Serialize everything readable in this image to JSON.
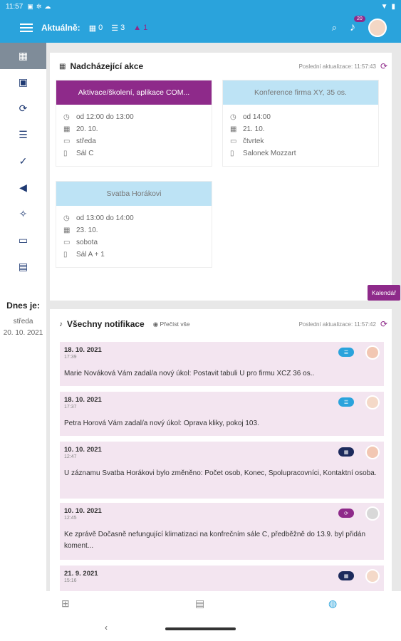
{
  "status": {
    "time": "11:57"
  },
  "appbar": {
    "aktualne_label": "Aktuálně:",
    "counters": [
      {
        "icon": "calendar-icon",
        "value": "0"
      },
      {
        "icon": "tasks-icon",
        "value": "3"
      },
      {
        "icon": "warning-icon",
        "value": "1"
      }
    ],
    "notifications_badge": "20"
  },
  "sidebar": {
    "items": [
      {
        "icon": "dashboard-grid-icon"
      },
      {
        "icon": "calendar-check-icon"
      },
      {
        "icon": "refresh-icon"
      },
      {
        "icon": "task-list-icon"
      },
      {
        "icon": "check-circle-icon"
      },
      {
        "icon": "megaphone-icon"
      },
      {
        "icon": "lightbulb-icon"
      },
      {
        "icon": "folder-icon"
      },
      {
        "icon": "calendar-grid-icon"
      }
    ],
    "today_label": "Dnes je:",
    "today_day": "středa",
    "today_date": "20. 10. 2021"
  },
  "upcoming": {
    "title": "Nadcházející akce",
    "updated": "Poslední aktualizace: 11:57:43",
    "calendar_button": "Kalendář",
    "events": [
      {
        "title": "Aktivace/školení, aplikace COM...",
        "time": "od 12:00 do 13:00",
        "date": "20. 10.",
        "day": "středa",
        "room": "Sál C"
      },
      {
        "title": "Konference firma XY, 35 os.",
        "time": "od 14:00",
        "date": "21. 10.",
        "day": "čtvrtek",
        "room": "Salonek Mozzart"
      },
      {
        "title": "Svatba Horákovi",
        "time": "od 13:00 do 14:00",
        "date": "23. 10.",
        "day": "sobota",
        "room": "Sál A + 1"
      }
    ]
  },
  "notifications": {
    "title": "Všechny notifikace",
    "read_all": "Přečíst vše",
    "updated": "Poslední aktualizace: 11:57:42",
    "items": [
      {
        "date": "18. 10. 2021",
        "time": "17:39",
        "text": "Marie Nováková Vám zadal/a nový úkol: Postavit tabuli U pro firmu XCZ 36 os.."
      },
      {
        "date": "18. 10. 2021",
        "time": "17:37",
        "text": "Petra Horová Vám zadal/a nový úkol: Oprava kliky, pokoj 103."
      },
      {
        "date": "10. 10. 2021",
        "time": "12:47",
        "text": "U záznamu Svatba Horákovi bylo změněno: Počet osob, Konec, Spolupracovníci, Kontaktní osoba."
      },
      {
        "date": "10. 10. 2021",
        "time": "12:45",
        "text": "Ke zprávě Dočasně nefungující klimatizaci na konfrečním sále C, předběžně do 13.9. byl přidán koment..."
      },
      {
        "date": "21. 9. 2021",
        "time": "15:16",
        "text": ""
      }
    ]
  }
}
